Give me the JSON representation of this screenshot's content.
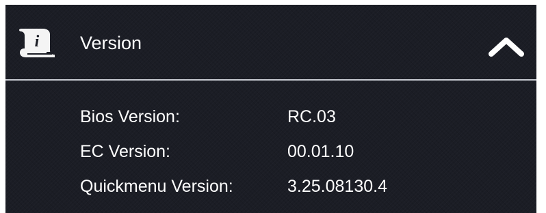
{
  "section": {
    "title": "Version",
    "icon": "info-scroll-icon",
    "toggle_icon": "chevron-up-icon"
  },
  "rows": [
    {
      "label": "Bios Version:",
      "value": "RC.03"
    },
    {
      "label": "EC Version:",
      "value": "00.01.10"
    },
    {
      "label": "Quickmenu Version:",
      "value": "3.25.08130.4"
    }
  ],
  "colors": {
    "background": "#1b1d25",
    "text": "#ffffff",
    "divider": "#c9ccd3"
  }
}
